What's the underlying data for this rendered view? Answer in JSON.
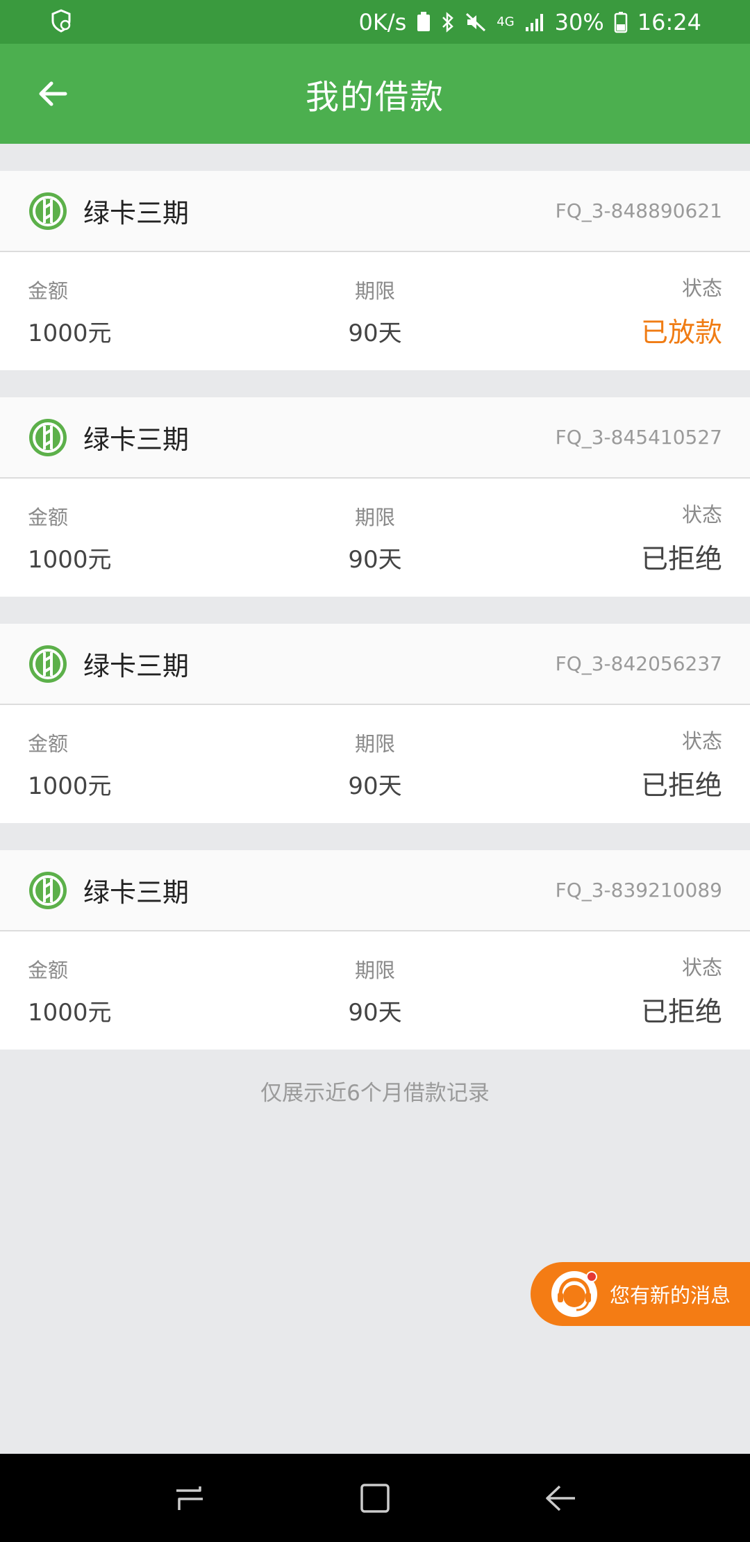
{
  "status_bar": {
    "speed": "0K/s",
    "network": "4G",
    "battery": "30%",
    "time": "16:24"
  },
  "header": {
    "title": "我的借款"
  },
  "loans": [
    {
      "name": "绿卡三期",
      "order_no": "FQ_3-848890621",
      "amount_label": "金额",
      "amount": "1000元",
      "term_label": "期限",
      "term": "90天",
      "status_label": "状态",
      "status": "已放款",
      "status_color": "#f07c14"
    },
    {
      "name": "绿卡三期",
      "order_no": "FQ_3-845410527",
      "amount_label": "金额",
      "amount": "1000元",
      "term_label": "期限",
      "term": "90天",
      "status_label": "状态",
      "status": "已拒绝",
      "status_color": "#444444"
    },
    {
      "name": "绿卡三期",
      "order_no": "FQ_3-842056237",
      "amount_label": "金额",
      "amount": "1000元",
      "term_label": "期限",
      "term": "90天",
      "status_label": "状态",
      "status": "已拒绝",
      "status_color": "#444444"
    },
    {
      "name": "绿卡三期",
      "order_no": "FQ_3-839210089",
      "amount_label": "金额",
      "amount": "1000元",
      "term_label": "期限",
      "term": "90天",
      "status_label": "状态",
      "status": "已拒绝",
      "status_color": "#444444"
    }
  ],
  "footnote": "仅展示近6个月借款记录",
  "chat_button": {
    "label": "您有新的消息",
    "icon": "customer-service-icon"
  },
  "colors": {
    "status_bar": "#3a9a3e",
    "app_bar": "#4caf4f",
    "accent_orange": "#f47c14",
    "background": "#e8e9eb"
  }
}
